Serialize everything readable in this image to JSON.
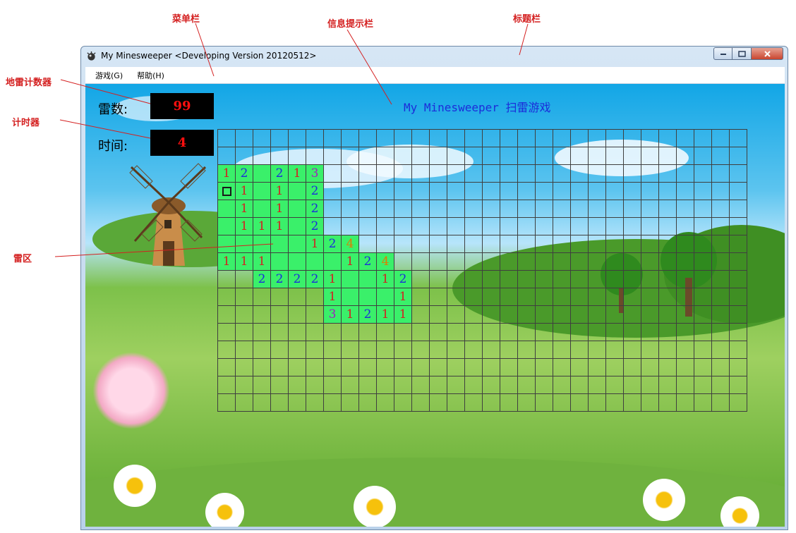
{
  "annotations": {
    "menubar": "菜单栏",
    "infobar": "信息提示栏",
    "titlebar": "标题栏",
    "mine_counter": "地雷计数器",
    "timer": "计时器",
    "minefield": "雷区"
  },
  "window": {
    "title": "My Minesweeper <Developing Version 20120512>",
    "controls": [
      "minimize-icon",
      "maximize-icon",
      "close-icon"
    ]
  },
  "menu": [
    {
      "label": "游戏(G)"
    },
    {
      "label": "帮助(H)"
    }
  ],
  "status": {
    "mines_label": "雷数:",
    "mines_value": "99",
    "time_label": "时间:",
    "time_value": "4"
  },
  "info_text": "My Minesweeper 扫雷游戏",
  "board": {
    "cols": 30,
    "rows": 16,
    "colors": {
      "open_cell": "#3af06a",
      "gridline": "#3f3f3f",
      "1": "#d32020",
      "2": "#1b2fd9",
      "3": "#a020c0",
      "4": "#e07b00"
    },
    "cells": [
      {
        "r": 2,
        "c": 0,
        "v": "1"
      },
      {
        "r": 2,
        "c": 1,
        "v": "2"
      },
      {
        "r": 2,
        "c": 2,
        "v": ""
      },
      {
        "r": 2,
        "c": 3,
        "v": "2"
      },
      {
        "r": 2,
        "c": 4,
        "v": "1"
      },
      {
        "r": 2,
        "c": 5,
        "v": "3"
      },
      {
        "r": 3,
        "c": 0,
        "v": "",
        "sel": true
      },
      {
        "r": 3,
        "c": 1,
        "v": "1"
      },
      {
        "r": 3,
        "c": 2,
        "v": ""
      },
      {
        "r": 3,
        "c": 3,
        "v": "1"
      },
      {
        "r": 3,
        "c": 4,
        "v": ""
      },
      {
        "r": 3,
        "c": 5,
        "v": "2"
      },
      {
        "r": 4,
        "c": 0,
        "v": ""
      },
      {
        "r": 4,
        "c": 1,
        "v": "1"
      },
      {
        "r": 4,
        "c": 2,
        "v": ""
      },
      {
        "r": 4,
        "c": 3,
        "v": "1"
      },
      {
        "r": 4,
        "c": 4,
        "v": ""
      },
      {
        "r": 4,
        "c": 5,
        "v": "2"
      },
      {
        "r": 5,
        "c": 0,
        "v": ""
      },
      {
        "r": 5,
        "c": 1,
        "v": "1"
      },
      {
        "r": 5,
        "c": 2,
        "v": "1"
      },
      {
        "r": 5,
        "c": 3,
        "v": "1"
      },
      {
        "r": 5,
        "c": 4,
        "v": ""
      },
      {
        "r": 5,
        "c": 5,
        "v": "2"
      },
      {
        "r": 6,
        "c": 0,
        "v": ""
      },
      {
        "r": 6,
        "c": 1,
        "v": ""
      },
      {
        "r": 6,
        "c": 2,
        "v": ""
      },
      {
        "r": 6,
        "c": 3,
        "v": ""
      },
      {
        "r": 6,
        "c": 4,
        "v": ""
      },
      {
        "r": 6,
        "c": 5,
        "v": "1"
      },
      {
        "r": 6,
        "c": 6,
        "v": "2"
      },
      {
        "r": 6,
        "c": 7,
        "v": "4"
      },
      {
        "r": 7,
        "c": 0,
        "v": "1"
      },
      {
        "r": 7,
        "c": 1,
        "v": "1"
      },
      {
        "r": 7,
        "c": 2,
        "v": "1"
      },
      {
        "r": 7,
        "c": 3,
        "v": ""
      },
      {
        "r": 7,
        "c": 4,
        "v": ""
      },
      {
        "r": 7,
        "c": 5,
        "v": ""
      },
      {
        "r": 7,
        "c": 6,
        "v": ""
      },
      {
        "r": 7,
        "c": 7,
        "v": "1"
      },
      {
        "r": 7,
        "c": 8,
        "v": "2"
      },
      {
        "r": 7,
        "c": 9,
        "v": "4"
      },
      {
        "r": 8,
        "c": 2,
        "v": "2"
      },
      {
        "r": 8,
        "c": 3,
        "v": "2"
      },
      {
        "r": 8,
        "c": 4,
        "v": "2"
      },
      {
        "r": 8,
        "c": 5,
        "v": "2"
      },
      {
        "r": 8,
        "c": 6,
        "v": "1"
      },
      {
        "r": 8,
        "c": 7,
        "v": ""
      },
      {
        "r": 8,
        "c": 8,
        "v": ""
      },
      {
        "r": 8,
        "c": 9,
        "v": "1"
      },
      {
        "r": 8,
        "c": 10,
        "v": "2"
      },
      {
        "r": 9,
        "c": 6,
        "v": "1"
      },
      {
        "r": 9,
        "c": 7,
        "v": ""
      },
      {
        "r": 9,
        "c": 8,
        "v": ""
      },
      {
        "r": 9,
        "c": 9,
        "v": ""
      },
      {
        "r": 9,
        "c": 10,
        "v": "1"
      },
      {
        "r": 10,
        "c": 6,
        "v": "3"
      },
      {
        "r": 10,
        "c": 7,
        "v": "1"
      },
      {
        "r": 10,
        "c": 8,
        "v": "2"
      },
      {
        "r": 10,
        "c": 9,
        "v": "1"
      },
      {
        "r": 10,
        "c": 10,
        "v": "1"
      }
    ]
  }
}
